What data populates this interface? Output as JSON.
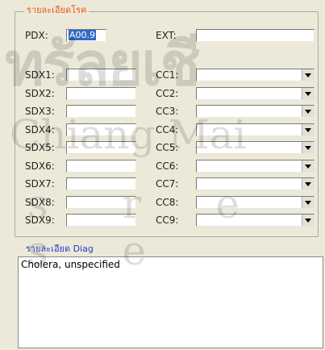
{
  "section_title": "รายละเอียดโรค",
  "pdx": {
    "label": "PDX:",
    "value": "A00.9"
  },
  "ext": {
    "label": "EXT:",
    "value": ""
  },
  "rows": [
    {
      "sdx_label": "SDX1:",
      "sdx_value": "",
      "cc_label": "CC1:",
      "cc_value": ""
    },
    {
      "sdx_label": "SDX2:",
      "sdx_value": "",
      "cc_label": "CC2:",
      "cc_value": ""
    },
    {
      "sdx_label": "SDX3:",
      "sdx_value": "",
      "cc_label": "CC3:",
      "cc_value": ""
    },
    {
      "sdx_label": "SDX4:",
      "sdx_value": "",
      "cc_label": "CC4:",
      "cc_value": ""
    },
    {
      "sdx_label": "SDX5:",
      "sdx_value": "",
      "cc_label": "CC5:",
      "cc_value": ""
    },
    {
      "sdx_label": "SDX6:",
      "sdx_value": "",
      "cc_label": "CC6:",
      "cc_value": ""
    },
    {
      "sdx_label": "SDX7:",
      "sdx_value": "",
      "cc_label": "CC7:",
      "cc_value": ""
    },
    {
      "sdx_label": "SDX8:",
      "sdx_value": "",
      "cc_label": "CC8:",
      "cc_value": ""
    },
    {
      "sdx_label": "SDX9:",
      "sdx_value": "",
      "cc_label": "CC9:",
      "cc_value": ""
    }
  ],
  "diag": {
    "title": "รายละเอียด Diag",
    "text": "Cholera, unspecified"
  },
  "watermark": {
    "line1": "ทรัลยเชี",
    "line2": "Chiang Mai",
    "line3": "s r e s e"
  },
  "colors": {
    "legend": "#e85a12",
    "diag_title": "#2040c8",
    "selection": "#316ac5",
    "background": "#ece9d8"
  },
  "icons": {
    "combo_arrow": "chevron-down-icon"
  }
}
